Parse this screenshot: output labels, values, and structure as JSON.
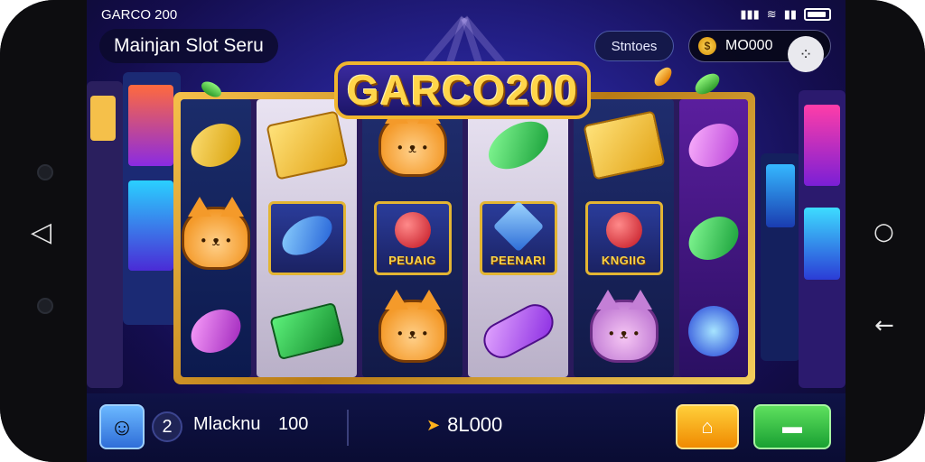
{
  "status_bar": {
    "left_text": "GARCO 200",
    "icons": [
      "signal-icon",
      "wifi-icon",
      "signal-icon",
      "battery-icon"
    ]
  },
  "header": {
    "title": "Mainjan Slot Seru",
    "status_button": "Stntoes",
    "coins": "MO000"
  },
  "game": {
    "logo": "GARCO200",
    "reel_labels": [
      "PEUAIG",
      "PEENARI",
      "KNGIIG"
    ]
  },
  "bottom": {
    "level": "2",
    "machine_label": "Mlacknu",
    "machine_value": "100",
    "bet": "8L000"
  },
  "device_nav": {
    "left": [
      "camera",
      "back-triangle",
      "camera"
    ],
    "right": [
      "menu-dots",
      "home-circle",
      "back-arrow"
    ]
  }
}
